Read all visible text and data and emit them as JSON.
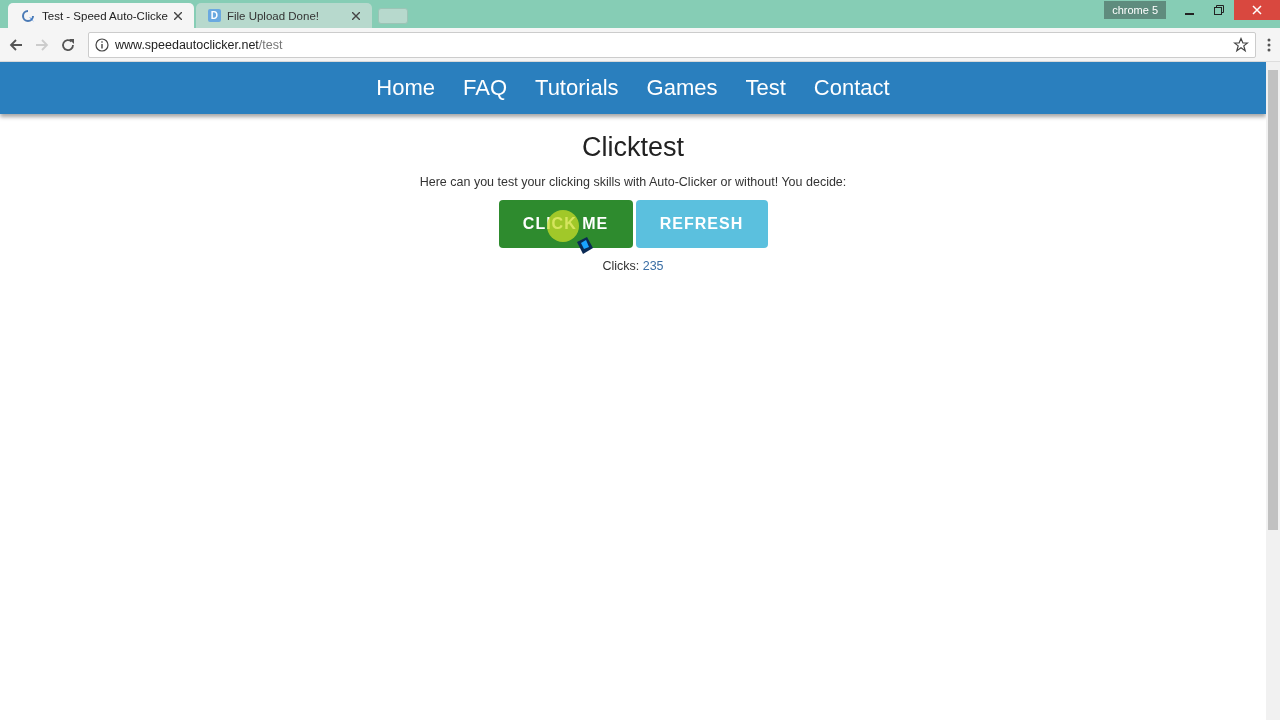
{
  "window": {
    "label": "chrome 5"
  },
  "tabs": [
    {
      "title": "Test - Speed Auto-Clicke",
      "kind": "loading",
      "selected": true
    },
    {
      "title": "File Upload Done!",
      "kind": "letter",
      "icon_text": "D",
      "selected": false
    }
  ],
  "address_bar": {
    "domain": "www.speedautoclicker.net",
    "path": "/test"
  },
  "nav": {
    "items": [
      "Home",
      "FAQ",
      "Tutorials",
      "Games",
      "Test",
      "Contact"
    ]
  },
  "page": {
    "heading": "Clicktest",
    "intro": "Here can you test your clicking skills with Auto-Clicker or without! You decide:",
    "buttons": [
      {
        "label": "CLICK ME",
        "kind": "primary"
      },
      {
        "label": "REFRESH",
        "kind": "secondary"
      }
    ],
    "clicks_label": "Clicks:",
    "clicks_value": "235"
  }
}
